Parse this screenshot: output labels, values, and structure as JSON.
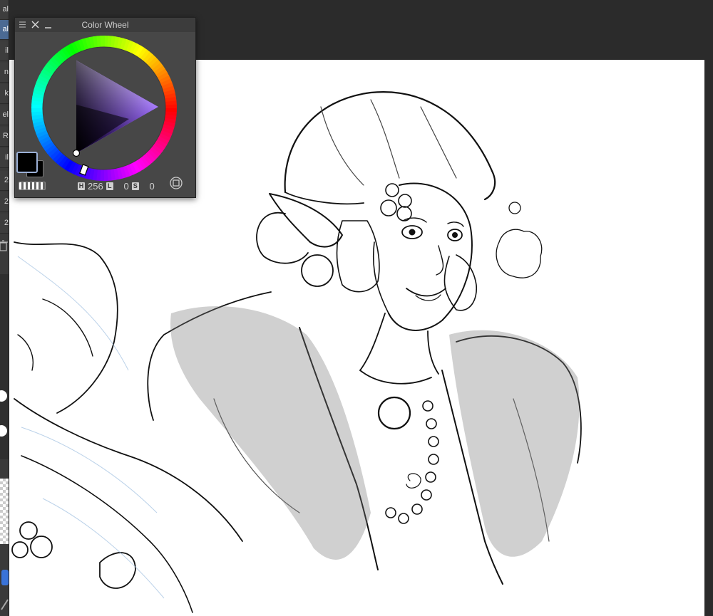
{
  "sidebar": {
    "items": [
      {
        "label": "al"
      },
      {
        "label": "al"
      },
      {
        "label": "il"
      },
      {
        "label": "n"
      },
      {
        "label": "k"
      },
      {
        "label": "el"
      },
      {
        "label": "R"
      },
      {
        "label": "il"
      },
      {
        "label": "2"
      },
      {
        "label": "2"
      },
      {
        "label": "2"
      }
    ]
  },
  "color_wheel": {
    "title": "Color Wheel",
    "h_label": "H",
    "h_value": "256",
    "l_label": "L",
    "l_value": "0",
    "s_label": "S",
    "s_value": "0",
    "main_color": "#000000",
    "sub_color": "#000000"
  }
}
